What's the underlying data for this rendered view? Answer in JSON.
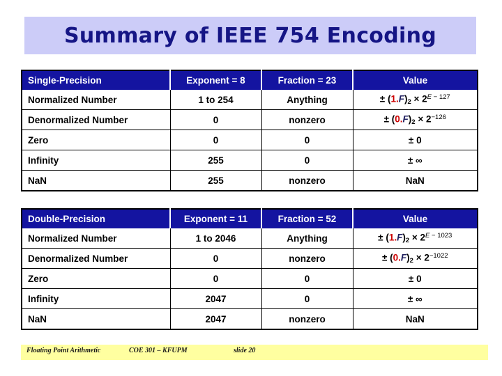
{
  "slide": {
    "title": "Summary of IEEE 754 Encoding",
    "title_band_color": "#ccccf8",
    "title_text_color": "#151585"
  },
  "tables": [
    {
      "id": "single",
      "header_bg": "#1414a0",
      "headers": {
        "kind": "Single-Precision",
        "exponent": "Exponent = 8",
        "fraction": "Fraction = 23",
        "value": "Value"
      },
      "rows": [
        {
          "kind": "Normalized Number",
          "exponent": "1 to 254",
          "fraction": "Anything",
          "value": {
            "prefix": "± (",
            "lead": "1.",
            "frac_sym": "F",
            "close": ")",
            "base_sub": "2",
            "times": "×",
            "pow_base": "2",
            "pow_exp_ital": "E",
            "pow_exp_rest": " − 127",
            "plain": ""
          }
        },
        {
          "kind": "Denormalized Number",
          "exponent": "0",
          "fraction": "nonzero",
          "value": {
            "prefix": "± (",
            "lead": "0.",
            "frac_sym": "F",
            "close": ")",
            "base_sub": "2",
            "times": "×",
            "pow_base": "2",
            "pow_exp_ital": "",
            "pow_exp_rest": "−126",
            "plain": ""
          }
        },
        {
          "kind": "Zero",
          "exponent": "0",
          "fraction": "0",
          "value": {
            "plain": "± 0"
          }
        },
        {
          "kind": "Infinity",
          "exponent": "255",
          "fraction": "0",
          "value": {
            "plain": "± ∞"
          }
        },
        {
          "kind": "NaN",
          "exponent": "255",
          "fraction": "nonzero",
          "value": {
            "plain": "NaN"
          }
        }
      ]
    },
    {
      "id": "double",
      "header_bg": "#1414a0",
      "headers": {
        "kind": "Double-Precision",
        "exponent": "Exponent = 11",
        "fraction": "Fraction = 52",
        "value": "Value"
      },
      "rows": [
        {
          "kind": "Normalized Number",
          "exponent": "1 to 2046",
          "fraction": "Anything",
          "value": {
            "prefix": "± (",
            "lead": "1.",
            "frac_sym": "F",
            "close": ")",
            "base_sub": "2",
            "times": "×",
            "pow_base": "2",
            "pow_exp_ital": "E",
            "pow_exp_rest": " − 1023",
            "plain": ""
          }
        },
        {
          "kind": "Denormalized Number",
          "exponent": "0",
          "fraction": "nonzero",
          "value": {
            "prefix": "± (",
            "lead": "0.",
            "frac_sym": "F",
            "close": ")",
            "base_sub": "2",
            "times": "×",
            "pow_base": "2",
            "pow_exp_ital": "",
            "pow_exp_rest": "−1022",
            "plain": ""
          }
        },
        {
          "kind": "Zero",
          "exponent": "0",
          "fraction": "0",
          "value": {
            "plain": "± 0"
          }
        },
        {
          "kind": "Infinity",
          "exponent": "2047",
          "fraction": "0",
          "value": {
            "plain": "± ∞"
          }
        },
        {
          "kind": "NaN",
          "exponent": "2047",
          "fraction": "nonzero",
          "value": {
            "plain": "NaN"
          }
        }
      ]
    }
  ],
  "footer": {
    "background": "#ffffa0",
    "left": "Floating Point Arithmetic",
    "center": "COE 301 – KFUPM",
    "right": "slide 20"
  }
}
